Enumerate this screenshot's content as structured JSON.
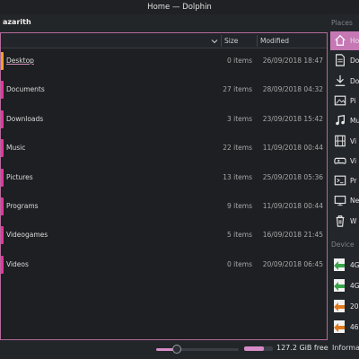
{
  "window": {
    "title": "Home — Dolphin"
  },
  "breadcrumb": {
    "label": "azarith"
  },
  "columns": {
    "size": "Size",
    "modified": "Modified"
  },
  "files": [
    {
      "name": "Desktop",
      "size": "0 items",
      "modified": "26/09/2018 18:47",
      "icon": "folder-orange-icon",
      "current": true
    },
    {
      "name": "Documents",
      "size": "27 items",
      "modified": "28/09/2018 04:32",
      "icon": "folder-icon"
    },
    {
      "name": "Downloads",
      "size": "3 items",
      "modified": "23/09/2018 15:42",
      "icon": "folder-icon"
    },
    {
      "name": "Music",
      "size": "22 items",
      "modified": "11/09/2018 00:44",
      "icon": "folder-icon"
    },
    {
      "name": "Pictures",
      "size": "13 items",
      "modified": "25/09/2018 05:36",
      "icon": "folder-icon"
    },
    {
      "name": "Programs",
      "size": "9 items",
      "modified": "11/09/2018 00:44",
      "icon": "folder-icon"
    },
    {
      "name": "Videogames",
      "size": "5 items",
      "modified": "16/09/2018 21:45",
      "icon": "folder-icon"
    },
    {
      "name": "Videos",
      "size": "0 items",
      "modified": "20/09/2018 06:45",
      "icon": "folder-icon"
    }
  ],
  "sidebar": {
    "places_title": "Places",
    "places": [
      {
        "label": "Ho",
        "icon": "home-icon",
        "active": true
      },
      {
        "label": "Do",
        "icon": "document-icon"
      },
      {
        "label": "Do",
        "icon": "download-icon"
      },
      {
        "label": "Pi",
        "icon": "picture-icon"
      },
      {
        "label": "Mu",
        "icon": "music-icon"
      },
      {
        "label": "Vi",
        "icon": "film-icon"
      },
      {
        "label": "Vi",
        "icon": "gamepad-icon"
      },
      {
        "label": "Pr",
        "icon": "terminal-icon"
      },
      {
        "label": "Ne",
        "icon": "network-icon"
      },
      {
        "label": "W",
        "icon": "trash-icon"
      }
    ],
    "devices_title": "Device",
    "devices": [
      {
        "label": "4G",
        "icon": "drive-icon"
      },
      {
        "label": "4G",
        "icon": "drive-icon"
      },
      {
        "label": "20",
        "icon": "drive-icon"
      },
      {
        "label": "46",
        "icon": "drive-icon"
      }
    ]
  },
  "statusbar": {
    "free_space": "127.2 GiB free",
    "info_label": "Informa",
    "zoom_level": 0.25,
    "space_used": 0.7
  },
  "colors": {
    "accent": "#c678b5",
    "folder": "#e6359f",
    "desktop_folder": "#f0a030"
  }
}
